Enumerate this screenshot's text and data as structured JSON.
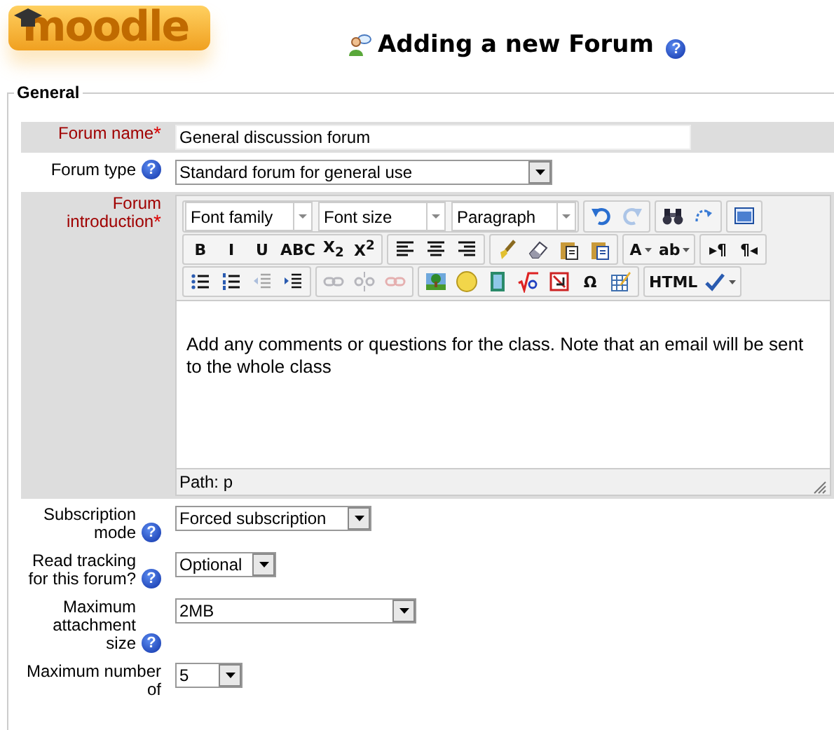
{
  "logo": "moodle",
  "page_title": "Adding a new Forum",
  "title_help": "?",
  "fieldset": {
    "legend": "General"
  },
  "fields": [
    {
      "kind": "text",
      "label": "Forum name",
      "required_mark": "*",
      "value": "General discussion forum"
    },
    {
      "kind": "select",
      "label": "Forum type",
      "help": "?",
      "value": "Standard forum for general use"
    },
    {
      "kind": "editor",
      "label": "Forum introduction",
      "required_mark": "*"
    },
    {
      "kind": "select",
      "label": "Subscription mode",
      "help": "?",
      "value": "Forced subscription"
    },
    {
      "kind": "select",
      "label": "Read tracking for this forum?",
      "help": "?",
      "value": "Optional"
    },
    {
      "kind": "select",
      "label": "Maximum attachment size",
      "help": "?",
      "value": "2MB"
    },
    {
      "kind": "select",
      "label": "Maximum number of",
      "value": "5"
    }
  ],
  "editor": {
    "toolbar": [
      [
        [
          {
            "kind": "select",
            "label": "Font family"
          },
          {
            "kind": "select",
            "label": "Font size"
          },
          {
            "kind": "select",
            "label": "Paragraph"
          }
        ],
        [
          {
            "kind": "icon",
            "disabled": false
          },
          {
            "kind": "icon",
            "disabled": true
          }
        ],
        [
          {
            "kind": "icon",
            "disabled": false
          },
          {
            "kind": "icon",
            "disabled": false
          }
        ],
        [
          {
            "kind": "icon",
            "disabled": false
          }
        ]
      ],
      [
        [
          {
            "kind": "glyph",
            "label": "B",
            "disabled": false
          },
          {
            "kind": "glyph",
            "label": "I",
            "disabled": false
          },
          {
            "kind": "glyph",
            "label": "U",
            "disabled": false
          },
          {
            "kind": "glyph",
            "label": "ABC",
            "disabled": false
          },
          {
            "kind": "glyph",
            "label": "X$_{2}$",
            "disabled": false
          },
          {
            "kind": "glyph",
            "label": "X$^{2}$",
            "disabled": false
          }
        ],
        [
          {
            "kind": "icon",
            "disabled": false
          },
          {
            "kind": "icon",
            "disabled": false
          },
          {
            "kind": "icon",
            "disabled": false
          }
        ],
        [
          {
            "kind": "icon",
            "disabled": false
          },
          {
            "kind": "icon",
            "disabled": false
          },
          {
            "kind": "icon",
            "disabled": false
          },
          {
            "kind": "icon",
            "disabled": false
          }
        ],
        [
          {
            "kind": "glyph",
            "label": "A",
            "disabled": false,
            "split": true
          },
          {
            "kind": "glyph",
            "label": "ab",
            "disabled": false,
            "split": true
          }
        ],
        [
          {
            "kind": "glyph",
            "label": "▸¶",
            "disabled": false
          },
          {
            "kind": "glyph",
            "label": "¶◂",
            "disabled": false
          }
        ]
      ],
      [
        [
          {
            "kind": "icon",
            "disabled": false
          },
          {
            "kind": "icon",
            "disabled": false
          },
          {
            "kind": "icon",
            "disabled": true
          },
          {
            "kind": "icon",
            "disabled": false
          }
        ],
        [
          {
            "kind": "icon",
            "disabled": true
          },
          {
            "kind": "icon",
            "disabled": true
          },
          {
            "kind": "icon",
            "disabled": true
          }
        ],
        [
          {
            "kind": "icon",
            "disabled": false
          },
          {
            "kind": "icon",
            "disabled": false
          },
          {
            "kind": "icon",
            "disabled": false
          },
          {
            "kind": "icon",
            "disabled": false
          },
          {
            "kind": "icon",
            "disabled": false
          },
          {
            "kind": "glyph",
            "label": "Ω",
            "disabled": false
          },
          {
            "kind": "icon",
            "disabled": false
          }
        ],
        [
          {
            "kind": "glyph",
            "label": "HTML",
            "disabled": false
          },
          {
            "kind": "icon",
            "disabled": false,
            "split": true
          }
        ]
      ]
    ],
    "content": "Add any comments or questions for the class. Note that an email will be sent to the whole class",
    "path": "Path: p"
  }
}
